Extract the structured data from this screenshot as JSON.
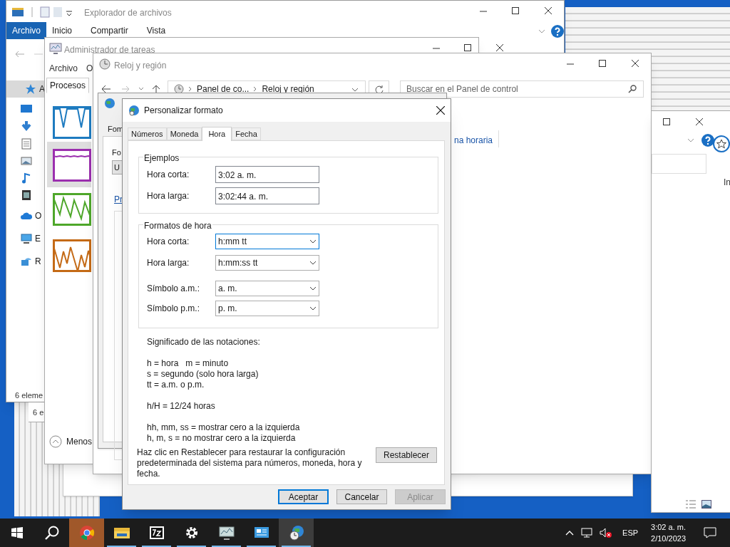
{
  "explorer": {
    "title": "Explorador de archivos",
    "ribbon_tabs": [
      {
        "label": "Archivo",
        "selected": true
      },
      {
        "label": "Inicio",
        "selected": false
      },
      {
        "label": "Compartir",
        "selected": false
      },
      {
        "label": "Vista",
        "selected": false
      }
    ],
    "nav_items": [
      {
        "kind": "star",
        "label": "A",
        "selected": true
      },
      {
        "kind": "desktop",
        "selected": false
      },
      {
        "kind": "download",
        "selected": false
      },
      {
        "kind": "document",
        "selected": false
      },
      {
        "kind": "image",
        "selected": false
      },
      {
        "kind": "music",
        "selected": false
      },
      {
        "kind": "video",
        "selected": false
      },
      {
        "kind": "cloud",
        "label": "O",
        "selected": false
      },
      {
        "kind": "pc",
        "label": "E",
        "selected": false
      },
      {
        "kind": "network",
        "label": "R",
        "selected": false
      }
    ],
    "status": "6 eleme"
  },
  "back_window": {
    "status": "6 e"
  },
  "task_manager": {
    "title": "Administrador de tareas",
    "menu": [
      "Archivo",
      "O"
    ],
    "tabs": [
      {
        "label": "Procesos",
        "selected": true
      }
    ],
    "graphs": [
      {
        "color": "#1e7bc0",
        "selected": false
      },
      {
        "color": "#9b2fae",
        "selected": true
      },
      {
        "color": "#4ea72a",
        "selected": false
      },
      {
        "color": "#c46a16",
        "selected": false
      }
    ],
    "less_button": "Menos"
  },
  "control_panel": {
    "title": "Reloj y región",
    "breadcrumb": [
      "Panel de co...",
      "Reloj y región"
    ],
    "search": {
      "placeholder": "Buscar en el Panel de control"
    },
    "link": "na horaria"
  },
  "region_dialog": {
    "tab": "Fom",
    "label": "Fo",
    "field": "U",
    "link": "Pr"
  },
  "right_window": {
    "text": "In"
  },
  "dialog": {
    "title": "Personalizar formato",
    "tabs": [
      {
        "label": "Números",
        "selected": false
      },
      {
        "label": "Moneda",
        "selected": false
      },
      {
        "label": "Hora",
        "selected": true
      },
      {
        "label": "Fecha",
        "selected": false
      }
    ],
    "examples": {
      "title": "Ejemplos",
      "rows": [
        {
          "label": "Hora corta:",
          "value": "3:02 a. m."
        },
        {
          "label": "Hora larga:",
          "value": "3:02:44 a. m."
        }
      ]
    },
    "formats": {
      "title": "Formatos de hora",
      "rows": [
        {
          "label": "Hora corta:",
          "value": "h:mm tt",
          "focused": true
        },
        {
          "label": "Hora larga:",
          "value": "h:mm:ss tt",
          "focused": false
        },
        {
          "label": "Símbolo a.m.:",
          "value": "a. m.",
          "focused": false
        },
        {
          "label": "Símbolo p.m.:",
          "value": "p. m.",
          "focused": false
        }
      ]
    },
    "notes_title": "Significado de las notaciones:",
    "notes": [
      [
        "h = hora   m = minuto",
        "s = segundo (solo hora larga)",
        "tt = a.m. o p.m."
      ],
      [
        "h/H = 12/24 horas"
      ],
      [
        "hh, mm, ss = mostrar cero a la izquierda",
        "h, m, s = no mostrar cero a la izquierda"
      ]
    ],
    "reset_text": "Haz clic en Restablecer para restaurar la configuración predeterminada del sistema para números, moneda, hora y fecha.",
    "reset_button": "Restablecer",
    "buttons": [
      {
        "label": "Aceptar",
        "kind": "default"
      },
      {
        "label": "Cancelar",
        "kind": "normal"
      },
      {
        "label": "Aplicar",
        "kind": "disabled"
      }
    ]
  },
  "taskbar": {
    "apps": [
      {
        "kind": "chrome",
        "open": false,
        "active": false,
        "flashing": true
      },
      {
        "kind": "folder",
        "open": true,
        "active": false,
        "flashing": false
      },
      {
        "kind": "archive",
        "open": true,
        "active": false,
        "flashing": false
      },
      {
        "kind": "gear",
        "open": true,
        "active": false,
        "flashing": false
      },
      {
        "kind": "monitor",
        "open": true,
        "active": false,
        "flashing": false
      },
      {
        "kind": "panel",
        "open": true,
        "active": false,
        "flashing": false
      },
      {
        "kind": "globe",
        "open": true,
        "active": true,
        "flashing": false
      }
    ],
    "language": "ESP",
    "time": "3:02 a. m.",
    "date": "2/10/2023"
  }
}
